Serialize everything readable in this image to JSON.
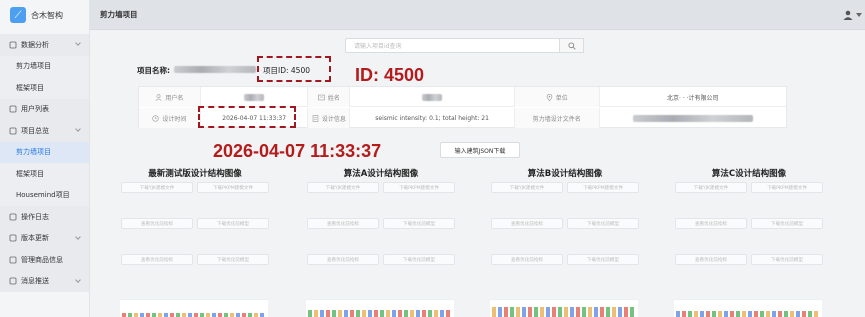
{
  "app": {
    "name": "合木智构"
  },
  "header": {
    "title": "剪力墙项目"
  },
  "sidebar": {
    "items": [
      {
        "label": "数据分析",
        "type": "group",
        "icon": "chart-icon",
        "arrow": true
      },
      {
        "label": "剪力墙项目",
        "type": "sub"
      },
      {
        "label": "框架项目",
        "type": "sub"
      },
      {
        "label": "用户列表",
        "type": "group",
        "icon": "user-icon",
        "arrow": false
      },
      {
        "label": "项目总览",
        "type": "group",
        "icon": "grid-icon",
        "arrow": true
      },
      {
        "label": "剪力墙项目",
        "type": "sub",
        "active": true
      },
      {
        "label": "框架项目",
        "type": "sub"
      },
      {
        "label": "Housemind项目",
        "type": "sub"
      },
      {
        "label": "操作日志",
        "type": "group",
        "icon": "log-icon",
        "arrow": false
      },
      {
        "label": "版本更新",
        "type": "group",
        "icon": "version-icon",
        "arrow": true
      },
      {
        "label": "管理商品信息",
        "type": "group",
        "icon": "goods-icon",
        "arrow": false
      },
      {
        "label": "消息推送",
        "type": "group",
        "icon": "message-icon",
        "arrow": true
      }
    ]
  },
  "search": {
    "placeholder": "请输入项目id查询"
  },
  "project": {
    "name_label": "项目名称:",
    "id_text": "项目ID:  4500"
  },
  "annotations": {
    "id_big": "ID: 4500",
    "time_big": "2026-04-07 11:33:37",
    "color": "#b41c1c"
  },
  "info": {
    "user_label": "用户名",
    "name_label": "姓名",
    "unit_label": "单位",
    "unit_value": "北京·   ·  ·计有限公司",
    "time_label": "设计时间",
    "time_value": "2026-04-07 11:33:37",
    "design_info_label": "设计信息",
    "design_info_value": "seismic intensity: 0.1; total height: 21",
    "file_label": "剪力墙设计文件名"
  },
  "json_button": "输入建筑JSON下载",
  "columns": [
    {
      "title": "最新测试版设计结构图像"
    },
    {
      "title": "算法A设计结构图像"
    },
    {
      "title": "算法B设计结构图像"
    },
    {
      "title": "算法C设计结构图像"
    }
  ],
  "buttons": {
    "yjk": "下载YJK建模文件",
    "pkpm": "下载PKPM建模文件",
    "view_opt": "查看优化前指标",
    "download_opt": "下载优化前模型"
  }
}
